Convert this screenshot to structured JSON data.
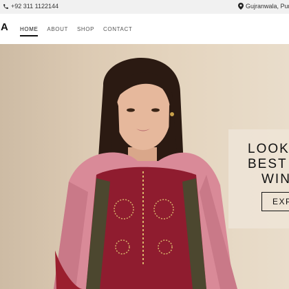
{
  "topbar": {
    "phone": "+92 311 1122144",
    "location": "Gujranwala, Punja",
    "phone_icon": "phone-icon",
    "location_icon": "map-pin-icon"
  },
  "header": {
    "logo": "A",
    "nav": [
      {
        "label": "HOME",
        "active": true
      },
      {
        "label": "ABOUT",
        "active": false
      },
      {
        "label": "SHOP",
        "active": false
      },
      {
        "label": "CONTACT",
        "active": false
      }
    ]
  },
  "hero": {
    "headline_lines": [
      "LOOK",
      "BEST",
      "WIN"
    ],
    "cta_label": "EXP"
  },
  "colors": {
    "topbar_bg": "#f1f1f1",
    "hero_bg": "#dccab3",
    "text": "#111111"
  }
}
